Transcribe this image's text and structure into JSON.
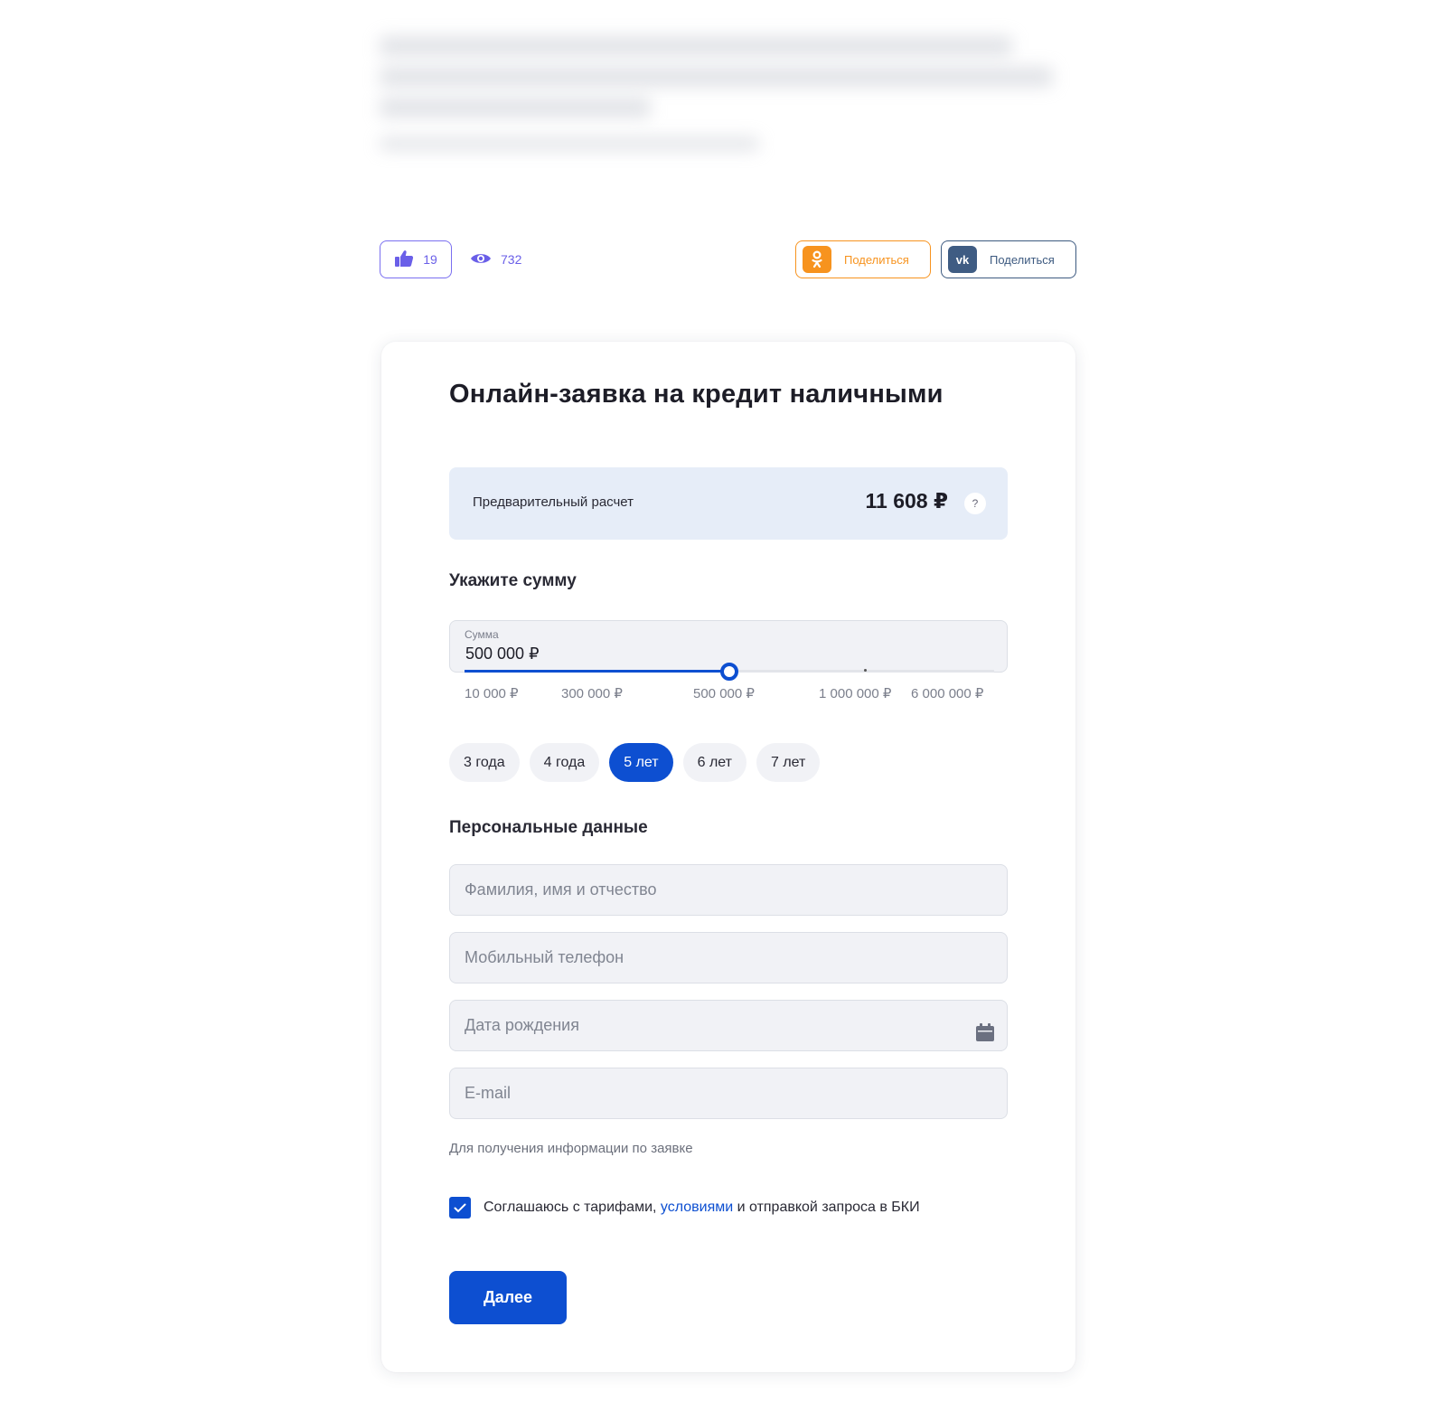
{
  "stats": {
    "likes": "19",
    "views": "732"
  },
  "share": {
    "ok_label": "Поделиться",
    "vk_label": "Поделиться",
    "vk_badge": "vk"
  },
  "form": {
    "title": "Онлайн-заявка на кредит наличными",
    "estimate": {
      "label": "Предварительный расчет",
      "value": "11 608 ₽",
      "help": "?"
    },
    "amount": {
      "heading": "Укажите сумму",
      "caption": "Сумма",
      "value": "500 000 ₽",
      "slider_fraction": 0.5,
      "ticks": [
        "10 000 ₽",
        "300 000 ₽",
        "500 000 ₽",
        "1 000 000 ₽",
        "6 000 000 ₽"
      ]
    },
    "terms": [
      {
        "label": "3 года",
        "active": false
      },
      {
        "label": "4 года",
        "active": false
      },
      {
        "label": "5 лет",
        "active": true
      },
      {
        "label": "6 лет",
        "active": false
      },
      {
        "label": "7 лет",
        "active": false
      }
    ],
    "personal": {
      "heading": "Персональные данные",
      "name_placeholder": "Фамилия, имя и отчество",
      "phone_placeholder": "Мобильный телефон",
      "birth_placeholder": "Дата рождения",
      "email_placeholder": "E-mail",
      "email_hint": "Для получения информации по заявке"
    },
    "agreement": {
      "checked": true,
      "text_before": "Соглашаюсь с тарифами, ",
      "link": "условиями",
      "text_after": " и отправкой запроса в БКИ"
    },
    "submit_label": "Далее"
  },
  "colors": {
    "accent": "#0d4fd1",
    "like": "#6a5fe8",
    "ok": "#f7931e",
    "vk": "#3f5c83",
    "estimate_bg": "#e6edf8"
  },
  "icons": {
    "like": "thumbs-up-icon",
    "views": "eye-icon",
    "ok": "odnoklassniki-icon",
    "vk": "vk-icon",
    "calendar": "calendar-icon",
    "check": "checkmark-icon"
  }
}
